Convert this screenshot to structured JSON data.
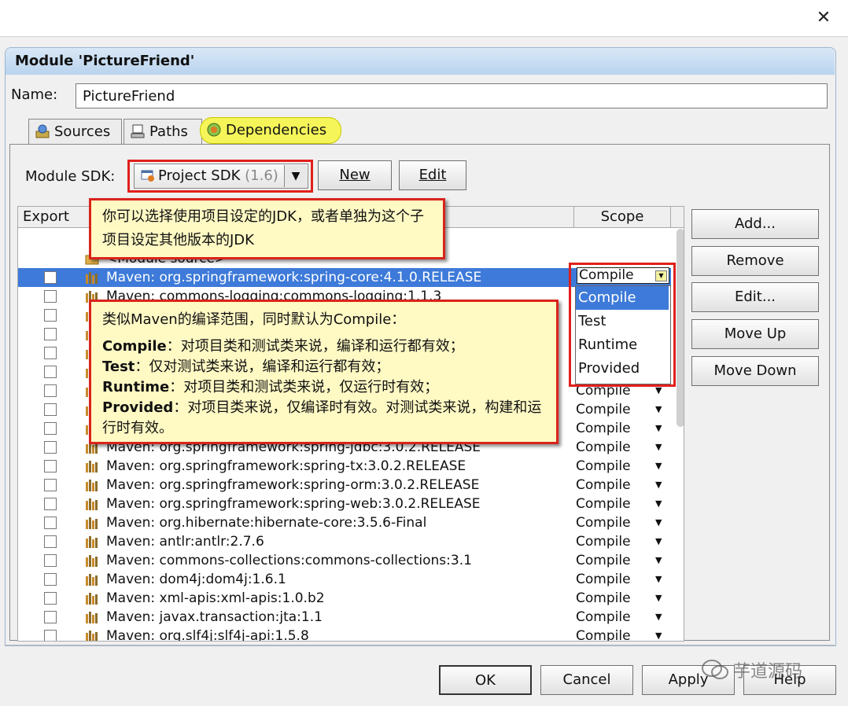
{
  "window": {
    "close_glyph": "✕"
  },
  "dialog": {
    "title": "Module 'PictureFriend'",
    "name_label": "Name:",
    "name_value": "PictureFriend"
  },
  "tabs": [
    {
      "label": "Sources",
      "icon": "sources-icon"
    },
    {
      "label": "Paths",
      "icon": "paths-icon"
    },
    {
      "label": "Dependencies",
      "icon": "dependencies-icon"
    }
  ],
  "sdk": {
    "label": "Module SDK:",
    "value": "Project SDK",
    "version": "(1.6)",
    "new_label": "New",
    "edit_label": "Edit"
  },
  "table": {
    "columns": {
      "export": "Export",
      "scope": "Scope"
    },
    "rows": [
      {
        "name": "<Module source>",
        "scope": "",
        "kind": "source"
      },
      {
        "name": "Maven: org.springframework:spring-core:4.1.0.RELEASE",
        "scope": "Compile",
        "kind": "lib",
        "selected": true
      },
      {
        "name": "Maven: commons-logging:commons-logging:1.1.3",
        "scope": "Compile",
        "kind": "lib"
      },
      {
        "name": "",
        "scope": "Compile",
        "kind": "lib"
      },
      {
        "name": "",
        "scope": "Compile",
        "kind": "lib"
      },
      {
        "name": "",
        "scope": "Compile",
        "kind": "lib"
      },
      {
        "name": "",
        "scope": "Compile",
        "kind": "lib"
      },
      {
        "name": "",
        "scope": "Compile",
        "kind": "lib"
      },
      {
        "name": "",
        "scope": "Compile",
        "kind": "lib"
      },
      {
        "name": "",
        "scope": "Compile",
        "kind": "lib"
      },
      {
        "name": "Maven: org.springframework:spring-jdbc:3.0.2.RELEASE",
        "scope": "Compile",
        "kind": "lib"
      },
      {
        "name": "Maven: org.springframework:spring-tx:3.0.2.RELEASE",
        "scope": "Compile",
        "kind": "lib"
      },
      {
        "name": "Maven: org.springframework:spring-orm:3.0.2.RELEASE",
        "scope": "Compile",
        "kind": "lib"
      },
      {
        "name": "Maven: org.springframework:spring-web:3.0.2.RELEASE",
        "scope": "Compile",
        "kind": "lib"
      },
      {
        "name": "Maven: org.hibernate:hibernate-core:3.5.6-Final",
        "scope": "Compile",
        "kind": "lib"
      },
      {
        "name": "Maven: antlr:antlr:2.7.6",
        "scope": "Compile",
        "kind": "lib"
      },
      {
        "name": "Maven: commons-collections:commons-collections:3.1",
        "scope": "Compile",
        "kind": "lib"
      },
      {
        "name": "Maven: dom4j:dom4j:1.6.1",
        "scope": "Compile",
        "kind": "lib"
      },
      {
        "name": "Maven: xml-apis:xml-apis:1.0.b2",
        "scope": "Compile",
        "kind": "lib"
      },
      {
        "name": "Maven: javax.transaction:jta:1.1",
        "scope": "Compile",
        "kind": "lib"
      },
      {
        "name": "Maven: org.slf4j:slf4j-api:1.5.8",
        "scope": "Compile",
        "kind": "lib"
      }
    ]
  },
  "scope_dropdown": {
    "current": "Compile",
    "options": [
      "Compile",
      "Test",
      "Runtime",
      "Provided"
    ],
    "active_index": 0
  },
  "side_buttons": [
    "Add...",
    "Remove",
    "Edit...",
    "Move Up",
    "Move Down"
  ],
  "annotations": {
    "sdk_note": "你可以选择使用项目设定的JDK，或者单独为这个子项目设定其他版本的JDK",
    "scope_note_title": "类似Maven的编译范围，同时默认为Compile：",
    "scope_items": [
      {
        "term": "Compile",
        "desc": "：对项目类和测试类来说，编译和运行都有效；"
      },
      {
        "term": "Test",
        "desc": "：仅对测试类来说，编译和运行都有效；"
      },
      {
        "term": "Runtime",
        "desc": "：对项目类和测试类来说，仅运行时有效；"
      },
      {
        "term": "Provided",
        "desc": "：对项目类来说，仅编译时有效。对测试类来说，构建和运行时有效。"
      }
    ]
  },
  "dialog_buttons": {
    "ok": "OK",
    "cancel": "Cancel",
    "apply": "Apply",
    "help": "Help"
  },
  "watermark": "芋道源码",
  "colors": {
    "selection": "#3d7ad9",
    "highlight_border": "#e0201c",
    "note_bg": "#fff9c4",
    "tab_highlight": "#f5f55a"
  }
}
